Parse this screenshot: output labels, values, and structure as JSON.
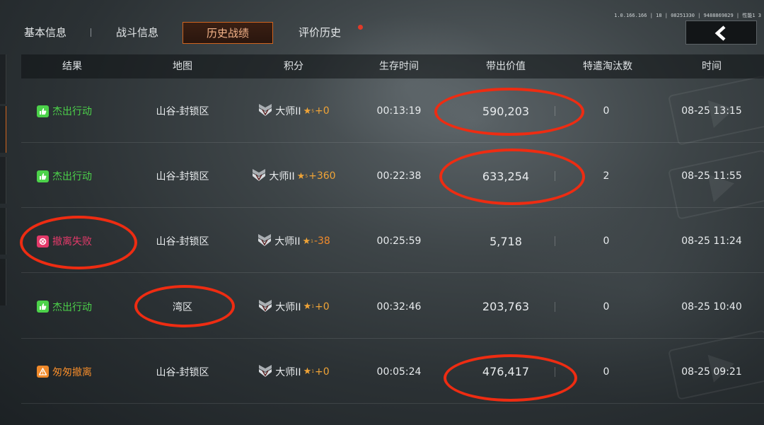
{
  "colors": {
    "accent_orange": "#d0641f",
    "win_green": "#4cd24a",
    "fail_pink": "#e33a6a",
    "hasty_orange": "#f08a2b",
    "star_gold": "#f0a437",
    "annotation_red": "#ee2c12"
  },
  "tabs": [
    {
      "label": "基本信息",
      "active": false
    },
    {
      "label": "战斗信息",
      "active": false
    },
    {
      "label": "历史战绩",
      "active": true
    },
    {
      "label": "评价历史",
      "active": false,
      "notification_dot": true
    }
  ],
  "server_info": "1.0.166.166 | 18 | 08251330 | 9488869829 | 性能1  3",
  "back_button_icon": "chevron-left-icon",
  "table": {
    "headers": [
      "结果",
      "地图",
      "积分",
      "生存时间",
      "带出价值",
      "特遣淘汰数",
      "时间"
    ],
    "rows": [
      {
        "result": "杰出行动",
        "result_type": "success",
        "map": "山谷-封锁区",
        "rank": "大师II",
        "star_sub": "5",
        "score_delta": "+0",
        "survival": "00:13:19",
        "value": "590,203",
        "eliminations": "0",
        "time": "08-25 13:15"
      },
      {
        "result": "杰出行动",
        "result_type": "success",
        "map": "山谷-封锁区",
        "rank": "大师II",
        "star_sub": "5",
        "score_delta": "+360",
        "survival": "00:22:38",
        "value": "633,254",
        "eliminations": "2",
        "time": "08-25 11:55"
      },
      {
        "result": "撤离失败",
        "result_type": "failed",
        "map": "山谷-封锁区",
        "rank": "大师II",
        "star_sub": "1",
        "score_delta": "-38",
        "survival": "00:25:59",
        "value": "5,718",
        "eliminations": "0",
        "time": "08-25 11:24"
      },
      {
        "result": "杰出行动",
        "result_type": "success",
        "map": "湾区",
        "rank": "大师II",
        "star_sub": "1",
        "score_delta": "+0",
        "survival": "00:32:46",
        "value": "203,763",
        "eliminations": "0",
        "time": "08-25 10:40"
      },
      {
        "result": "匆匆撤离",
        "result_type": "hasty",
        "map": "山谷-封锁区",
        "rank": "大师II",
        "star_sub": "1",
        "score_delta": "+0",
        "survival": "00:05:24",
        "value": "476,417",
        "eliminations": "0",
        "time": "08-25 09:21"
      }
    ]
  }
}
